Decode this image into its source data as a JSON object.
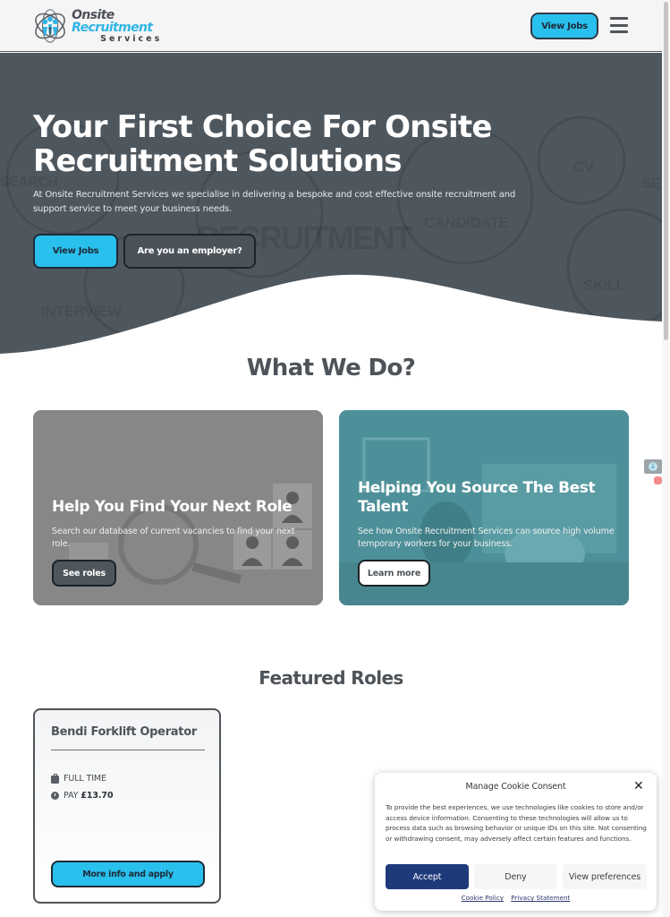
{
  "header": {
    "logo": {
      "line1_a": "Onsite",
      "line1_b": "Recruitment",
      "line2": "Services"
    },
    "view_jobs_label": "View Jobs",
    "menu_icon": "hamburger-menu-icon"
  },
  "hero": {
    "title": "Your First Choice For Onsite Recruitment Solutions",
    "subtitle": "At Onsite Recruitment Services we specialise in delivering a bespoke and cost effective onsite recruitment and support service to meet your business needs.",
    "primary_button": "View Jobs",
    "secondary_button": "Are you an employer?",
    "background_words": [
      "SEARCH",
      "RECRUITMENT",
      "CANDIDATE",
      "CV",
      "SKILL",
      "INTERVIEW",
      "SE"
    ]
  },
  "what_we_do": {
    "heading": "What We Do?",
    "cards": [
      {
        "title": "Help You Find Your Next Role",
        "text": "Search our database of current vacancies to find your next role.",
        "button": "See roles"
      },
      {
        "title": "Helping You Source The Best Talent",
        "text": "See how Onsite Recruitment Services can source high volume temporary workers for your business.",
        "button": "Learn more"
      }
    ]
  },
  "featured_roles": {
    "heading": "Featured Roles",
    "jobs": [
      {
        "title": "Bendi Forklift Operator",
        "type": "FULL TIME",
        "pay_label": "PAY",
        "pay_value": "£13.70",
        "button": "More info and apply"
      }
    ]
  },
  "cookie_consent": {
    "title": "Manage Cookie Consent",
    "close_icon": "close-icon",
    "body": "To provide the best experiences, we use technologies like cookies to store and/or access device information. Consenting to these technologies will allow us to process data such as browsing behavior or unique IDs on this site. Not consenting or withdrawing consent, may adversely affect certain features and functions.",
    "accept": "Accept",
    "deny": "Deny",
    "preferences": "View preferences",
    "links": [
      "Cookie Policy",
      "Privacy Statement"
    ]
  },
  "colors": {
    "brand_blue": "#29c0ee",
    "hero_bg": "#4f575e",
    "heading_text": "#4d5358",
    "accept_button": "#1f3a7a",
    "card2_teal": "#4d8f98"
  }
}
